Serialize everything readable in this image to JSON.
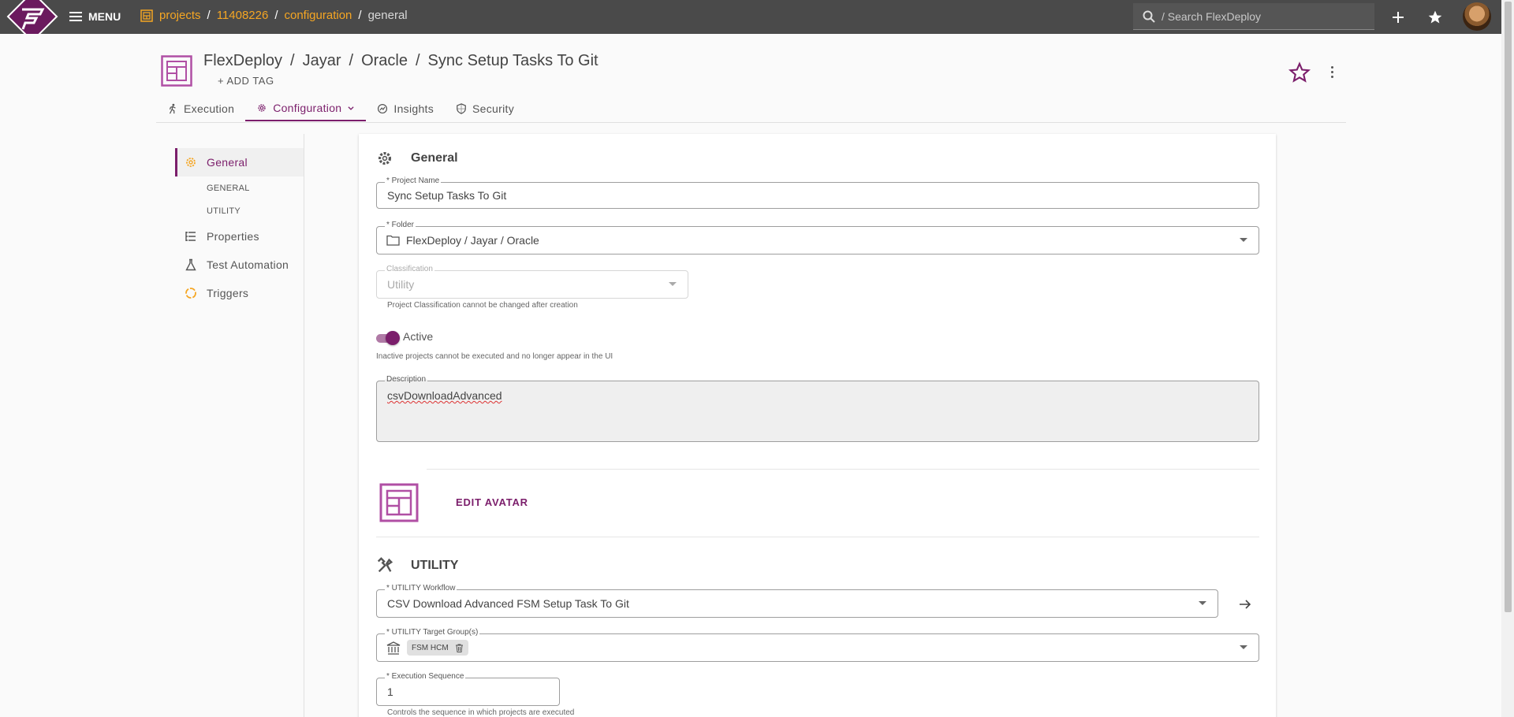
{
  "topbar": {
    "menu_label": "MENU",
    "breadcrumbs": [
      "projects",
      "11408226",
      "configuration",
      "general"
    ],
    "search_placeholder": "/ Search FlexDeploy"
  },
  "project": {
    "path": [
      "FlexDeploy",
      "Jayar",
      "Oracle",
      "Sync Setup Tasks To Git"
    ],
    "add_tag": "ADD TAG"
  },
  "tabs": [
    {
      "label": "Execution",
      "active": false
    },
    {
      "label": "Configuration",
      "active": true
    },
    {
      "label": "Insights",
      "active": false
    },
    {
      "label": "Security",
      "active": false
    }
  ],
  "leftnav": {
    "items": [
      {
        "label": "General",
        "active": true
      },
      {
        "label": "GENERAL"
      },
      {
        "label": "UTILITY"
      },
      {
        "label": "Properties"
      },
      {
        "label": "Test Automation"
      },
      {
        "label": "Triggers"
      }
    ]
  },
  "general": {
    "title": "General",
    "project_name_label": "* Project Name",
    "project_name_value": "Sync Setup Tasks To Git",
    "folder_label": "* Folder",
    "folder_value": "FlexDeploy / Jayar / Oracle",
    "classification_label": "Classification",
    "classification_value": "Utility",
    "classification_hint": "Project Classification cannot be changed after creation",
    "active_label": "Active",
    "active_on": true,
    "active_hint": "Inactive projects cannot be executed and no longer appear in the UI",
    "description_label": "Description",
    "description_value": "csvDownloadAdvanced",
    "edit_avatar": "EDIT AVATAR"
  },
  "utility": {
    "title": "UTILITY",
    "workflow_label": "* UTILITY Workflow",
    "workflow_value": "CSV Download Advanced FSM Setup Task To Git",
    "target_groups_label": "* UTILITY Target Group(s)",
    "target_group_chip": "FSM HCM",
    "exec_seq_label": "* Execution Sequence",
    "exec_seq_value": "1",
    "exec_seq_hint": "Controls the sequence in which projects are executed"
  },
  "colors": {
    "brand": "#7b1e6b",
    "accent_link": "#f5a623",
    "topbar": "#4a4a4a",
    "nav_icon_orange": "#f5a623"
  }
}
